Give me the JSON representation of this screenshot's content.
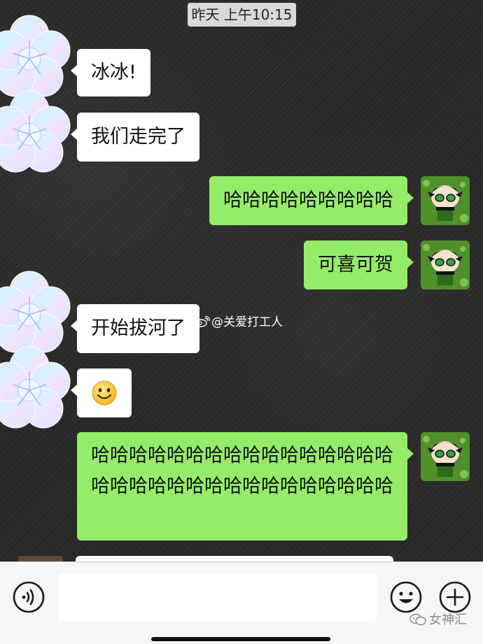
{
  "timestamp": "昨天 上午10:15",
  "messages": [
    {
      "side": "in",
      "text": "冰冰!"
    },
    {
      "side": "in",
      "text": "我们走完了"
    },
    {
      "side": "out",
      "text": "哈哈哈哈哈哈哈哈哈"
    },
    {
      "side": "out",
      "text": "可喜可贺"
    },
    {
      "side": "in",
      "text": "开始拔河了"
    },
    {
      "side": "in",
      "emoji": "smile"
    },
    {
      "side": "out",
      "text": "哈哈哈哈哈哈哈哈哈哈哈哈哈哈哈哈哈哈哈哈哈哈哈哈哈哈哈哈哈哈哈哈"
    }
  ],
  "watermark": "@关爱打工人",
  "input_bar": {
    "voice_icon": "voice-icon",
    "emoji_icon": "emoji-icon",
    "add_icon": "plus-icon",
    "text_value": "",
    "placeholder": ""
  },
  "brand": "女神汇",
  "colors": {
    "outgoing_bubble": "#95ec69",
    "incoming_bubble": "#ffffff",
    "chat_background": "#262626",
    "input_bar": "#f6f6f6"
  }
}
